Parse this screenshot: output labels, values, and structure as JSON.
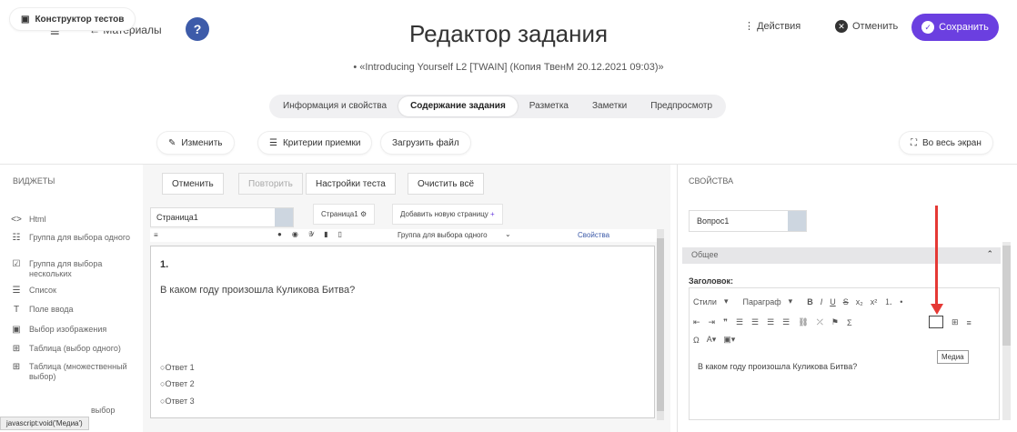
{
  "header": {
    "back_label": "← Материалы",
    "help_glyph": "?",
    "title": "Редактор задания",
    "subtitle": "• «Introducing Yourself L2 [TWAIN] (Копия ТвенМ 20.12.2021 09:03)»",
    "actions_label": "Действия",
    "cancel_label": "Отменить",
    "save_label": "Сохранить",
    "accent_color": "#6b3fe0"
  },
  "tabs": [
    "Информация и свойства",
    "Содержание задания",
    "Разметка",
    "Заметки",
    "Предпросмотр"
  ],
  "toolbar": {
    "constructor_label": "Конструктор тестов",
    "edit_label": "Изменить",
    "criteria_label": "Критерии приемки",
    "upload_label": "Загрузить файл",
    "fullscreen_label": "Во весь экран"
  },
  "widgets": {
    "title": "ВИДЖЕТЫ",
    "items": [
      {
        "icon": "code-icon",
        "label": "Html"
      },
      {
        "icon": "radio-list-icon",
        "label": "Группа для выбора одного"
      },
      {
        "icon": "checkbox-icon",
        "label": "Группа для выбора нескольких"
      },
      {
        "icon": "list-icon",
        "label": "Список"
      },
      {
        "icon": "text-icon",
        "label": "Поле ввода"
      },
      {
        "icon": "image-icon",
        "label": "Выбор изображения"
      },
      {
        "icon": "table-icon",
        "label": "Таблица (выбор одного)"
      },
      {
        "icon": "table-multi-icon",
        "label": "Таблица (множественный выбор)"
      },
      {
        "icon": "dropdown-icon",
        "label": "выбор"
      }
    ]
  },
  "editor": {
    "undo_label": "Отменить",
    "redo_label": "Повторить",
    "settings_label": "Настройки теста",
    "clear_label": "Очистить всё",
    "page_select": "Страница1",
    "page_tab": "Страница1",
    "add_page": "Добавить новую страницу",
    "question_type": "Группа для выбора одного",
    "properties_label": "Свойства",
    "question_number": "1.",
    "question_text": "В каком году произошла Куликова Битва?",
    "answers": [
      "Ответ 1",
      "Ответ 2",
      "Ответ 3"
    ]
  },
  "properties": {
    "title": "СВОЙСТВА",
    "question_select": "Вопрос1",
    "section": "Общее",
    "field_label": "Заголовок:",
    "styles_label": "Стили",
    "format_label": "Параграф",
    "content": "В каком году произошла Куликова Битва?",
    "tooltip": "Медиа"
  },
  "status_bar": "javascript:void('Медиа')"
}
